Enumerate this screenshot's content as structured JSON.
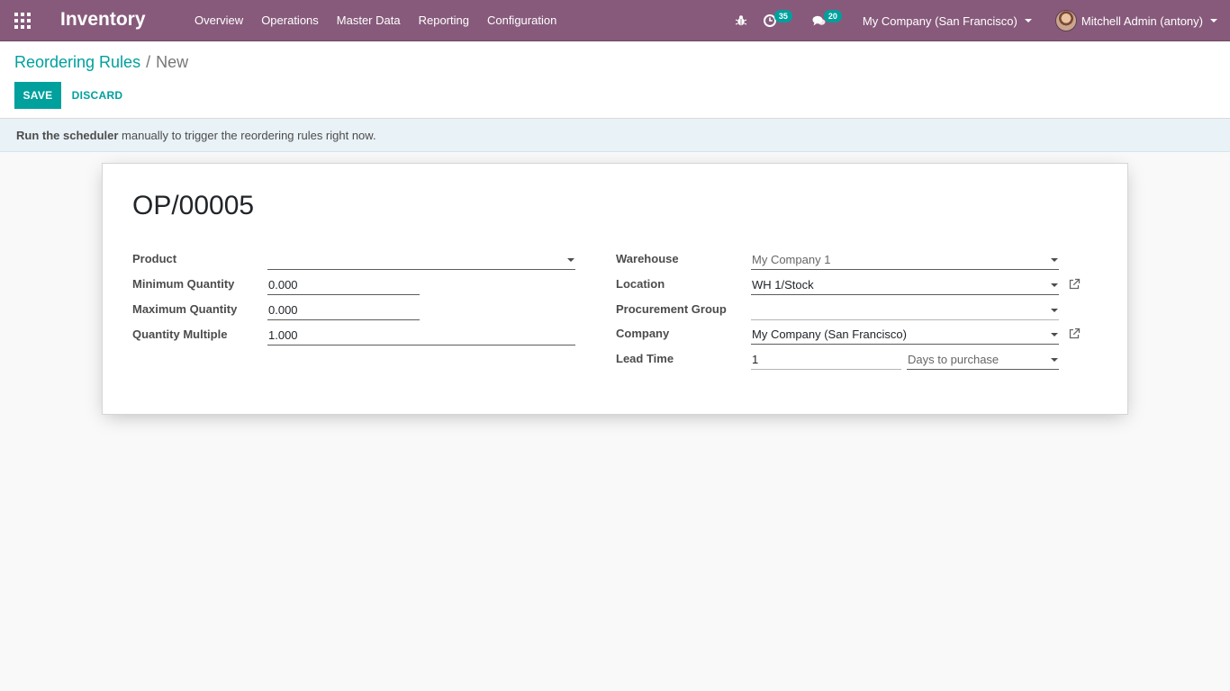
{
  "navbar": {
    "app_title": "Inventory",
    "menu": [
      "Overview",
      "Operations",
      "Master Data",
      "Reporting",
      "Configuration"
    ],
    "activity_count": "35",
    "message_count": "20",
    "company_switcher": "My Company (San Francisco)",
    "user": "Mitchell Admin (antony)"
  },
  "breadcrumb": {
    "parent": "Reordering Rules",
    "separator": "/",
    "current": "New"
  },
  "buttons": {
    "save": "SAVE",
    "discard": "DISCARD"
  },
  "alert": {
    "bold": "Run the scheduler",
    "rest": " manually to trigger the reordering rules right now."
  },
  "form": {
    "name": "OP/00005",
    "left": {
      "product_label": "Product",
      "product_value": "",
      "min_qty_label": "Minimum Quantity",
      "min_qty_value": "0.000",
      "max_qty_label": "Maximum Quantity",
      "max_qty_value": "0.000",
      "qty_multiple_label": "Quantity Multiple",
      "qty_multiple_value": "1.000"
    },
    "right": {
      "warehouse_label": "Warehouse",
      "warehouse_value": "My Company 1",
      "location_label": "Location",
      "location_value": "WH 1/Stock",
      "procurement_group_label": "Procurement Group",
      "procurement_group_value": "",
      "company_label": "Company",
      "company_value": "My Company (San Francisco)",
      "lead_time_label": "Lead Time",
      "lead_time_value": "1",
      "lead_type_value": "Days to purchase"
    }
  },
  "colors": {
    "navbar": "#875a7b",
    "accent": "#00a09d",
    "alert_bg": "#e9f2f7"
  }
}
